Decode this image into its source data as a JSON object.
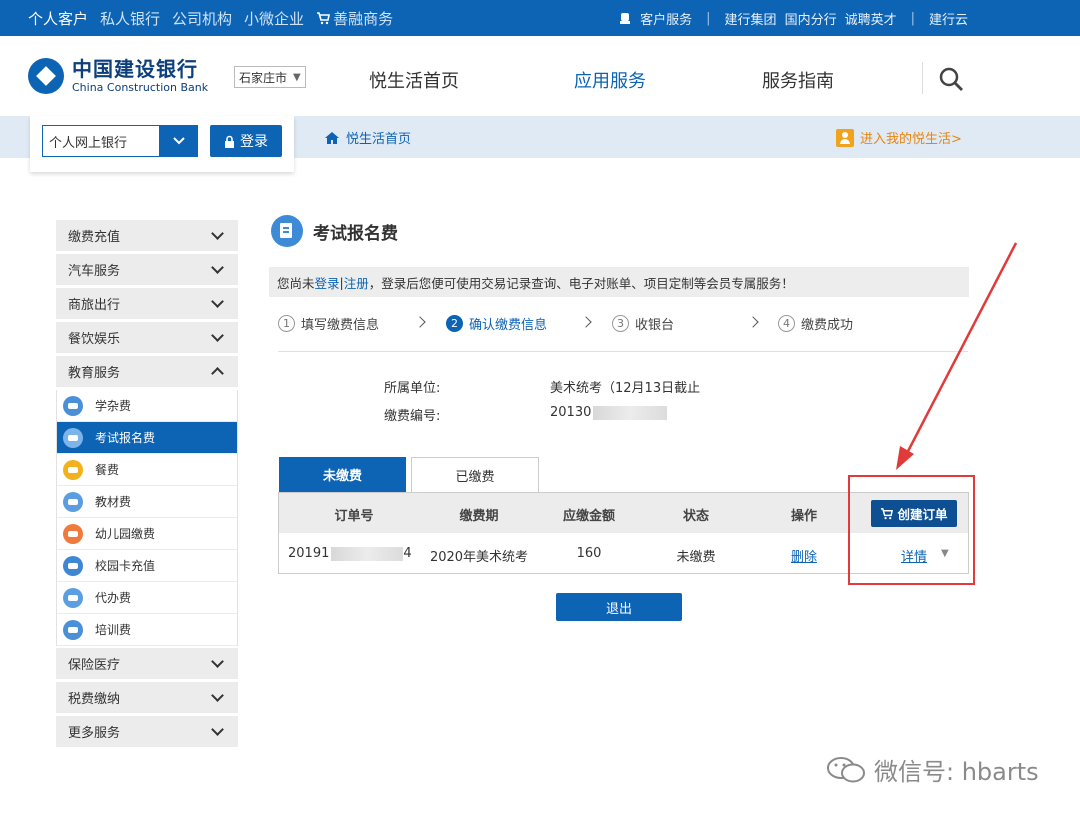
{
  "topbar": {
    "segments": [
      "个人客户",
      "私人银行",
      "公司机构",
      "小微企业",
      "善融商务"
    ],
    "links": [
      "客户服务",
      "建行集团",
      "国内分行",
      "诚聘英才",
      "建行云"
    ]
  },
  "header": {
    "logo_cn": "中国建设银行",
    "logo_en": "China Construction Bank",
    "city": "石家庄市",
    "nav": [
      "悦生活首页",
      "应用服务",
      "服务指南"
    ]
  },
  "login": {
    "bank_select": "个人网上银行",
    "login_label": "登录"
  },
  "subbar": {
    "breadcrumb": "悦生活首页",
    "enter_label": "进入我的悦生活>"
  },
  "sidebar": {
    "top_items": [
      "缴费充值",
      "汽车服务",
      "商旅出行",
      "餐饮娱乐"
    ],
    "expanded_item": "教育服务",
    "sub_items": [
      "学杂费",
      "考试报名费",
      "餐费",
      "教材费",
      "幼儿园缴费",
      "校园卡充值",
      "代办费",
      "培训费"
    ],
    "bottom_items": [
      "保险医疗",
      "税费缴纳",
      "更多服务"
    ]
  },
  "main": {
    "title": "考试报名费",
    "notice": {
      "prefix": "您尚未 ",
      "login": "登录",
      "sep": " | ",
      "register": "注册",
      "suffix": "，登录后您便可使用交易记录查询、电子对账单、项目定制等会员专属服务！"
    },
    "steps": [
      {
        "num": "1",
        "label": "填写缴费信息"
      },
      {
        "num": "2",
        "label": "确认缴费信息"
      },
      {
        "num": "3",
        "label": "收银台"
      },
      {
        "num": "4",
        "label": "缴费成功"
      }
    ],
    "info": {
      "unit_label": "所属单位:",
      "unit_value": "美术统考（12月13日截止",
      "code_label": "缴费编号:",
      "code_value": "20130"
    },
    "tabs": {
      "unpaid": "未缴费",
      "paid": "已缴费"
    },
    "table": {
      "headers": [
        "订单号",
        "缴费期",
        "应缴金额",
        "状态",
        "操作"
      ],
      "create_label": "创建订单",
      "row": {
        "order_prefix": "20191",
        "order_suffix": "4",
        "period": "2020年美术统考",
        "amount": "160",
        "status": "未缴费",
        "delete": "删除",
        "detail": "详情"
      }
    },
    "exit_label": "退出"
  },
  "watermark": "微信号: hbarts",
  "colors": {
    "brand": "#0d63b4",
    "highlight": "#e03a3a",
    "accent_orange": "#e9850f"
  }
}
